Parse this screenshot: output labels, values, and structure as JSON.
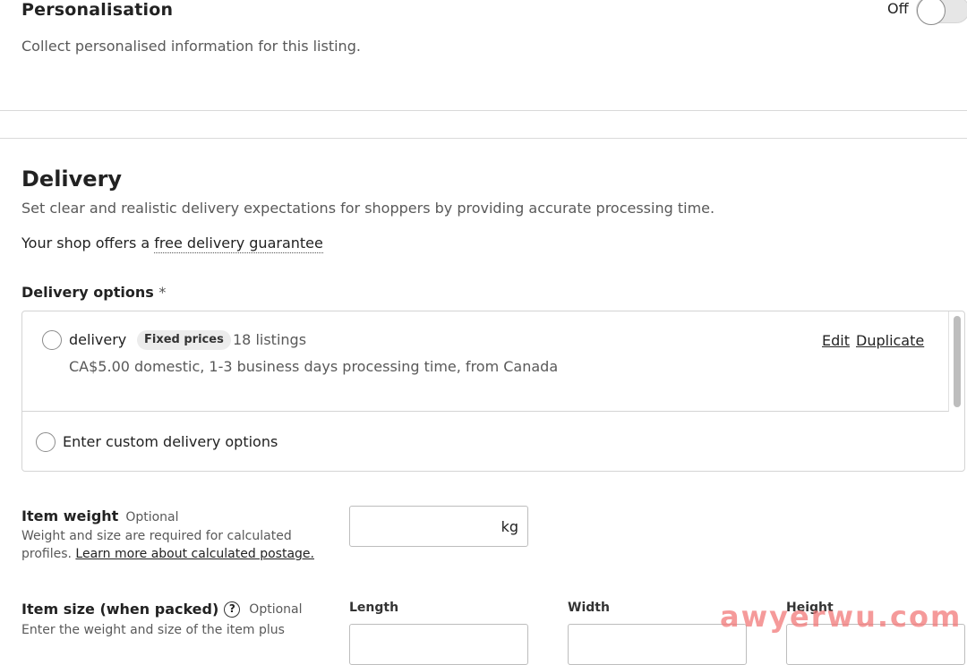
{
  "personalisation": {
    "title": "Personalisation",
    "description": "Collect personalised information for this listing.",
    "toggle_label": "Off"
  },
  "delivery": {
    "title": "Delivery",
    "description": "Set clear and realistic delivery expectations for shoppers by providing accurate processing time.",
    "guarantee_prefix": "Your shop offers a ",
    "guarantee_link": "free delivery guarantee",
    "options_label": "Delivery options",
    "required_mark": "*",
    "options": [
      {
        "name": "delivery",
        "badge": "Fixed prices",
        "count": "18 listings",
        "detail": "CA$5.00 domestic, 1-3 business days processing time, from Canada",
        "edit_label": "Edit",
        "duplicate_label": "Duplicate"
      }
    ],
    "custom_option_label": "Enter custom delivery options"
  },
  "item_weight": {
    "title": "Item weight",
    "optional": "Optional",
    "help_text": "Weight and size are required for calculated profiles. ",
    "help_link": "Learn more about calculated postage.",
    "unit": "kg"
  },
  "item_size": {
    "title": "Item size (when packed)",
    "optional": "Optional",
    "help_text": "Enter the weight and size of the item plus",
    "labels": {
      "length": "Length",
      "width": "Width",
      "height": "Height"
    }
  },
  "watermark": "awyerwu.com",
  "colors": {
    "text": "#222222",
    "muted": "#595959",
    "border": "#d4d4d4",
    "badge_bg": "#ececec"
  },
  "icons": {
    "help": "question-circle-icon"
  }
}
